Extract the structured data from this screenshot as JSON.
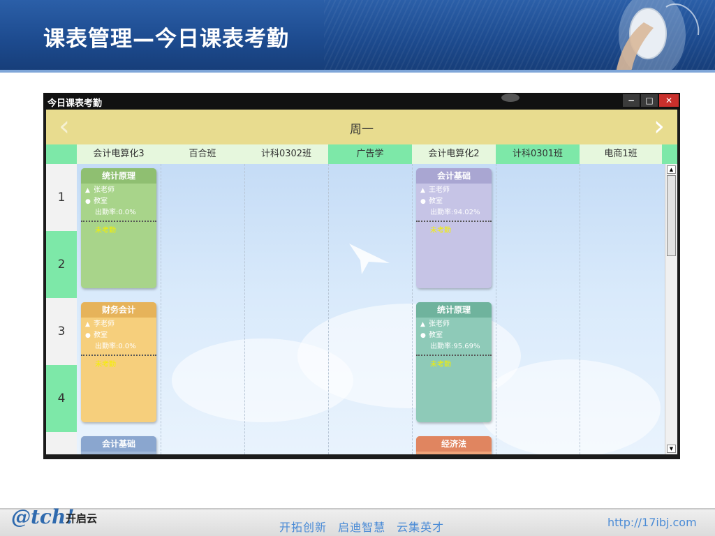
{
  "slide": {
    "title": "课表管理—今日课表考勤"
  },
  "window": {
    "title": "今日课表考勤",
    "minimize_glyph": "−",
    "maximize_glyph": "□",
    "close_glyph": "✕"
  },
  "schedule": {
    "day": "周一",
    "prev_glyph": "‹",
    "next_glyph": "›",
    "classes": [
      "会计电算化3",
      "百合班",
      "计科0302班",
      "广告学",
      "会计电算化2",
      "计科0301班",
      "电商1班"
    ],
    "periods": [
      "1",
      "2",
      "3",
      "4"
    ]
  },
  "cards": [
    {
      "course": "统计原理",
      "teacher": "张老师",
      "room": "教室",
      "rate": "出勤率:0.0%",
      "status": "未考勤",
      "color": "#a8d48a",
      "head_color": "#8fbf71"
    },
    {
      "course": "会计基础",
      "teacher": "王老师",
      "room": "教室",
      "rate": "出勤率:94.02%",
      "status": "未考勤",
      "color": "#c6c4e6",
      "head_color": "#a9a6d2"
    },
    {
      "course": "财务会计",
      "teacher": "李老师",
      "room": "教室",
      "rate": "出勤率:0.0%",
      "status": "未考勤",
      "color": "#f6cf7c",
      "head_color": "#e6b35a"
    },
    {
      "course": "统计原理",
      "teacher": "张老师",
      "room": "教室",
      "rate": "出勤率:95.69%",
      "status": "未考勤",
      "color": "#8ecab8",
      "head_color": "#6fb39d"
    },
    {
      "course": "会计基础",
      "color": "#9fb7d8",
      "head_color": "#8aa6cf"
    },
    {
      "course": "经济法",
      "color": "#f0a47a",
      "head_color": "#e08560"
    }
  ],
  "footer": {
    "logo": "@tch!",
    "brand": "开启云",
    "slogan": "开拓创新 启迪智慧 云集英才",
    "url": "http://17ibj.com"
  },
  "icons": {
    "user": "user-icon",
    "location": "location-pin-icon",
    "scroll_up": "▲",
    "scroll_down": "▼"
  }
}
